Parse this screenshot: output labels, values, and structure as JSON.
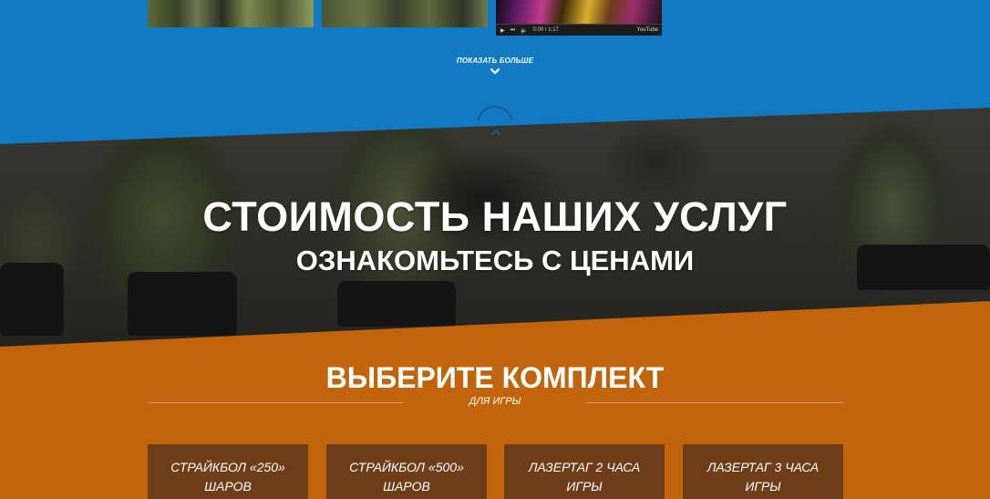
{
  "gallery": {
    "show_more_label": "ПОКАЗАТЬ БОЛЬШЕ",
    "video": {
      "time": "0:00 / 1:17",
      "progress": 0,
      "brand": "YouTube"
    }
  },
  "hero": {
    "title": "СТОИМОСТЬ НАШИХ УСЛУГ",
    "subtitle": "ОЗНАКОМЬТЕСЬ С ЦЕНАМИ"
  },
  "pricing": {
    "title": "ВЫБЕРИТЕ КОМПЛЕКТ",
    "subtitle": "ДЛЯ ИГРЫ",
    "cards": [
      {
        "line1": "СТРАЙКБОЛ «250»",
        "line2": "ШАРОВ"
      },
      {
        "line1": "СТРАЙКБОЛ «500»",
        "line2": "ШАРОВ"
      },
      {
        "line1": "ЛАЗЕРТАГ 2 ЧАСА",
        "line2": "ИГРЫ"
      },
      {
        "line1": "ЛАЗЕРТАГ 3 ЧАСА",
        "line2": "ИГРЫ"
      }
    ]
  },
  "colors": {
    "blue": "#1279c3",
    "orange": "#c1640b",
    "card": "#6e3e1a"
  }
}
